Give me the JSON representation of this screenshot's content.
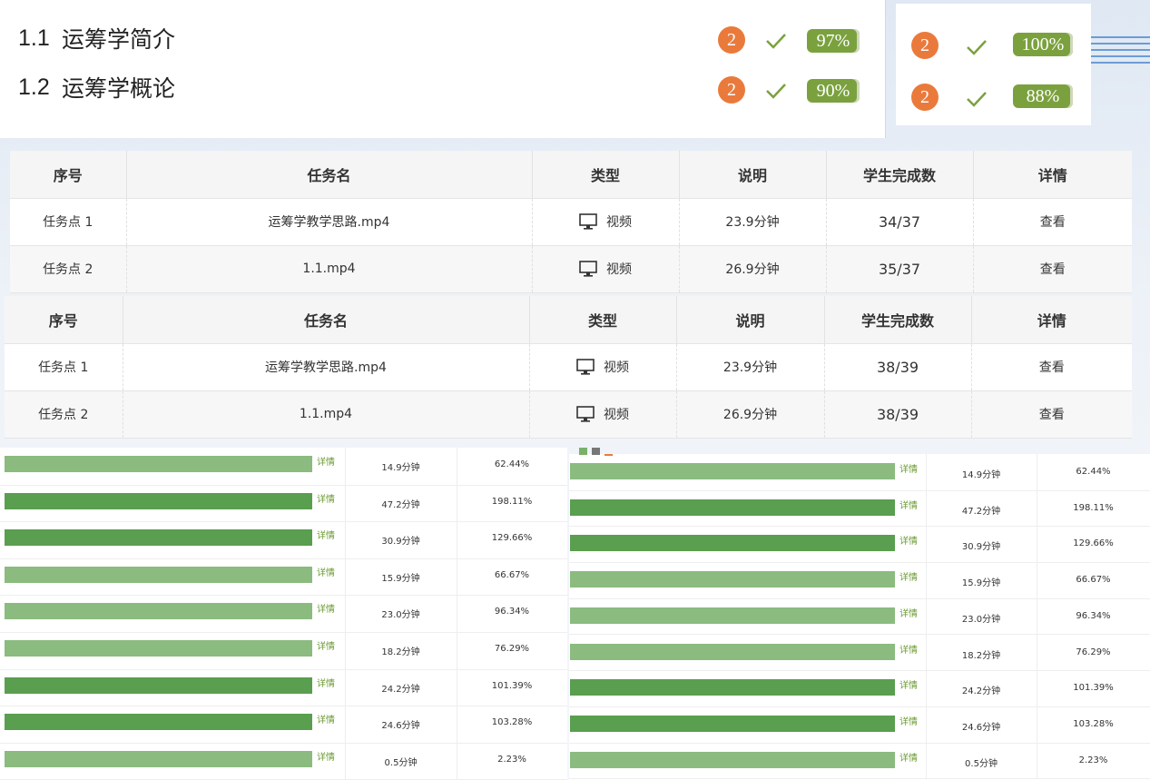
{
  "course": {
    "chapters": [
      {
        "num": "1.1",
        "title": "运筹学简介",
        "badge": "2",
        "percent": "97%"
      },
      {
        "num": "1.2",
        "title": "运筹学概论",
        "badge": "2",
        "percent": "90%"
      }
    ],
    "side": [
      {
        "badge": "2",
        "percent": "100%"
      },
      {
        "badge": "2",
        "percent": "88%"
      }
    ]
  },
  "tables": [
    {
      "headers": [
        "序号",
        "任务名",
        "类型",
        "说明",
        "学生完成数",
        "详情"
      ],
      "rows": [
        {
          "idx": "任务点 1",
          "name": "运筹学教学思路.mp4",
          "type": "视频",
          "desc": "23.9分钟",
          "count": "34/37",
          "detail": "查看"
        },
        {
          "idx": "任务点 2",
          "name": "1.1.mp4",
          "type": "视频",
          "desc": "26.9分钟",
          "count": "35/37",
          "detail": "查看"
        }
      ]
    },
    {
      "headers": [
        "序号",
        "任务名",
        "类型",
        "说明",
        "学生完成数",
        "详情"
      ],
      "rows": [
        {
          "idx": "任务点 1",
          "name": "运筹学教学思路.mp4",
          "type": "视频",
          "desc": "23.9分钟",
          "count": "38/39",
          "detail": "查看"
        },
        {
          "idx": "任务点 2",
          "name": "1.1.mp4",
          "type": "视频",
          "desc": "26.9分钟",
          "count": "38/39",
          "detail": "查看"
        }
      ]
    }
  ],
  "bars": {
    "detail_label": "详情",
    "colors": {
      "dark": "#5a9e4f",
      "light": "#8bbb7f"
    },
    "rows": [
      {
        "time": "14.9分钟",
        "pct": "62.44%",
        "shade": "light"
      },
      {
        "time": "47.2分钟",
        "pct": "198.11%",
        "shade": "dark"
      },
      {
        "time": "30.9分钟",
        "pct": "129.66%",
        "shade": "dark"
      },
      {
        "time": "15.9分钟",
        "pct": "66.67%",
        "shade": "light"
      },
      {
        "time": "23.0分钟",
        "pct": "96.34%",
        "shade": "light"
      },
      {
        "time": "18.2分钟",
        "pct": "76.29%",
        "shade": "light"
      },
      {
        "time": "24.2分钟",
        "pct": "101.39%",
        "shade": "dark"
      },
      {
        "time": "24.6分钟",
        "pct": "103.28%",
        "shade": "dark"
      },
      {
        "time": "0.5分钟",
        "pct": "2.23%",
        "shade": "light"
      }
    ]
  },
  "accent": {
    "badge": "#ea7a3c",
    "percent": "#7ba13e",
    "link": "#6a9a30"
  }
}
